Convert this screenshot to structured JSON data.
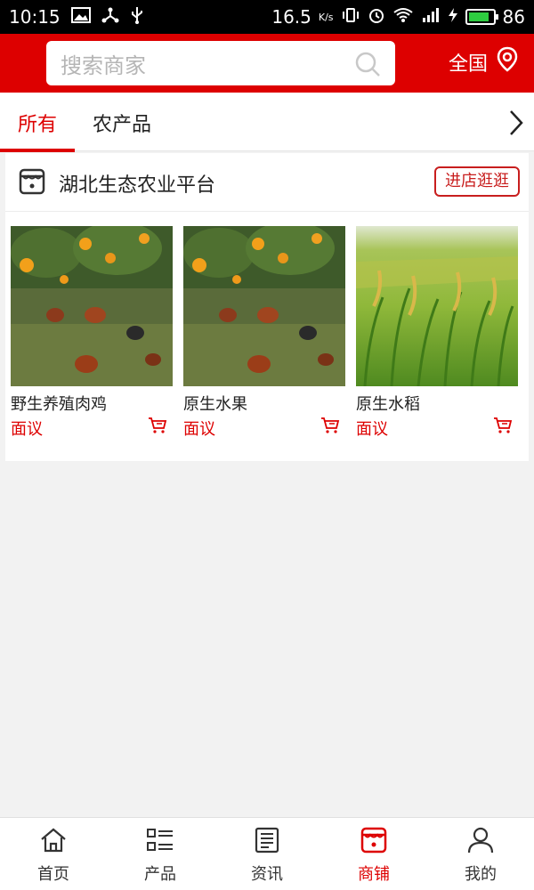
{
  "status_bar": {
    "time": "10:15",
    "speed": "16.5",
    "speed_unit": "K/s",
    "battery": "86",
    "battery_level": 0.86
  },
  "header": {
    "search_placeholder": "搜索商家",
    "region_label": "全国"
  },
  "tabs": [
    {
      "label": "所有",
      "active": true
    },
    {
      "label": "农产品",
      "active": false
    }
  ],
  "store": {
    "name": "湖北生态农业平台",
    "visit_label": "进店逛逛"
  },
  "products": [
    {
      "name": "野生养殖肉鸡",
      "price": "面议",
      "image": "orchard-chickens"
    },
    {
      "name": "原生水果",
      "price": "面议",
      "image": "orchard-chickens"
    },
    {
      "name": "原生水稻",
      "price": "面议",
      "image": "rice-field"
    }
  ],
  "bottom_nav": [
    {
      "label": "首页",
      "icon": "home-icon",
      "active": false
    },
    {
      "label": "产品",
      "icon": "list-icon",
      "active": false
    },
    {
      "label": "资讯",
      "icon": "news-icon",
      "active": false
    },
    {
      "label": "商铺",
      "icon": "shop-icon",
      "active": true
    },
    {
      "label": "我的",
      "icon": "user-icon",
      "active": false
    }
  ],
  "colors": {
    "brand_red": "#dd0000",
    "price_red": "#dd0000",
    "background": "#f2f2f2"
  }
}
